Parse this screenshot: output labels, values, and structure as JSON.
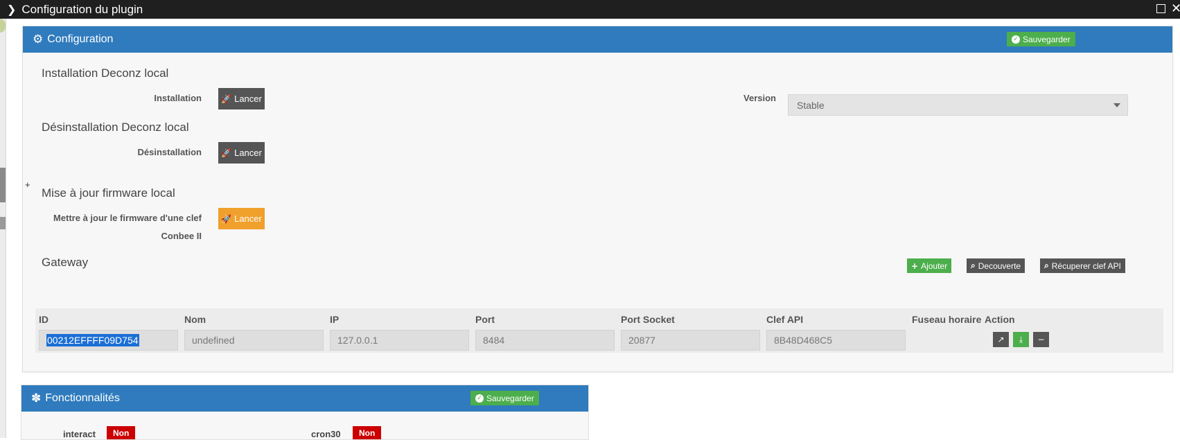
{
  "window": {
    "title": "Configuration du plugin"
  },
  "config_panel": {
    "title": "Configuration",
    "save_label": "Sauvegarder",
    "install": {
      "section_title": "Installation Deconz local",
      "label": "Installation",
      "button": "Lancer",
      "version_label": "Version",
      "version_value": "Stable"
    },
    "uninstall": {
      "section_title": "Désinstallation Deconz local",
      "label": "Désinstallation",
      "button": "Lancer"
    },
    "plus_text": "+",
    "firmware": {
      "section_title": "Mise à jour firmware local",
      "label_line1": "Mettre à jour le firmware d'une clef",
      "label_line2": "Conbee II",
      "button": "Lancer"
    },
    "gateway": {
      "section_title": "Gateway",
      "add_label": "Ajouter",
      "discover_label": "Decouverte",
      "get_key_label": "Récuperer clef API",
      "columns": [
        "ID",
        "Nom",
        "IP",
        "Port",
        "Port Socket",
        "Clef API",
        "Fuseau horaire",
        "Action"
      ],
      "rows": [
        {
          "id": "00212EFFFF09D754",
          "nom": "undefined",
          "ip": "127.0.0.1",
          "port": "8484",
          "port_socket": "20877",
          "clef_api": "8B48D468C5",
          "help": "?"
        }
      ]
    }
  },
  "features_panel": {
    "title": "Fonctionnalités",
    "save_label": "Sauvegarder",
    "items": [
      {
        "label": "interact",
        "value": "Non"
      },
      {
        "label": "cron30",
        "value": "Non"
      }
    ]
  },
  "colors": {
    "header_blue": "#2f7bbd",
    "save_green": "#4cae4c",
    "launch_orange": "#f0a02c",
    "badge_red": "#cc0000"
  }
}
